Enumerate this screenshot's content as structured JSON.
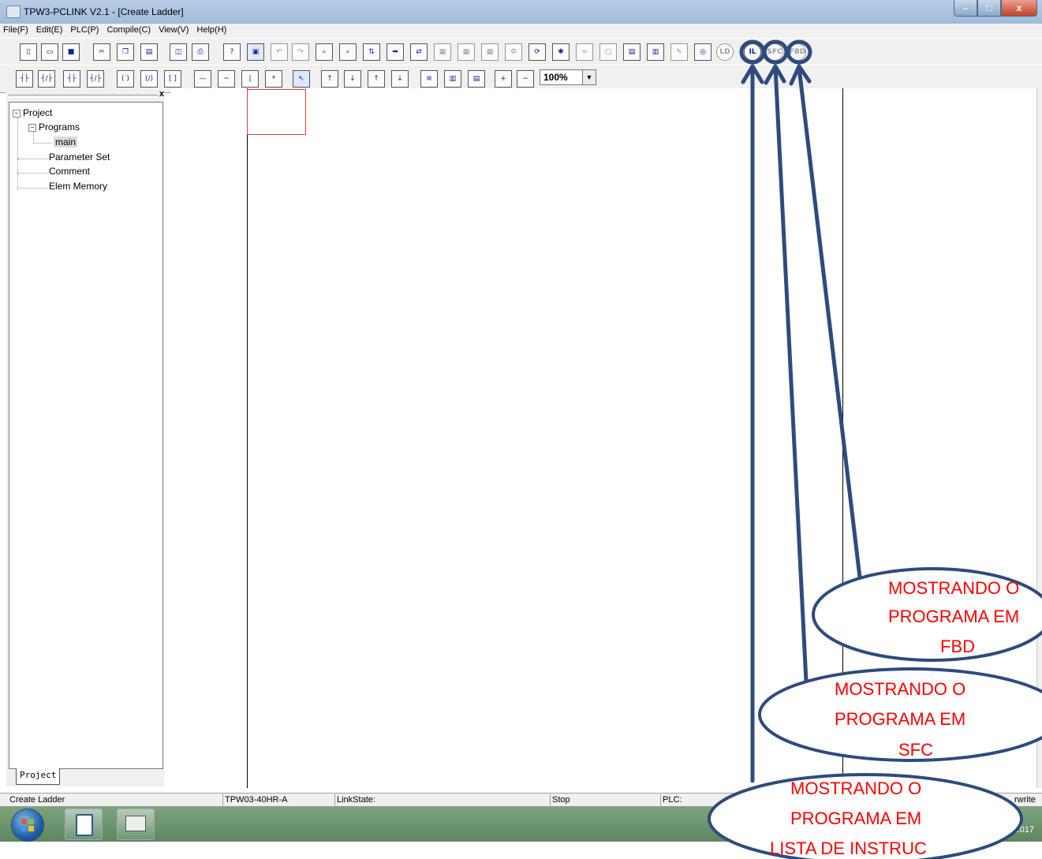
{
  "window": {
    "title": "TPW3-PCLINK V2.1 - [Create Ladder]",
    "minimize": "–",
    "maximize": "□",
    "close": "x"
  },
  "menu": [
    "File(F)",
    "Edit(E)",
    "PLC(P)",
    "Compile(C)",
    "View(V)",
    "Help(H)"
  ],
  "toolbar1": {
    "il_label": "IL",
    "sfc_label": "SFC",
    "fbd_label": "FBD",
    "ld_label": "LD"
  },
  "toolbar2": {
    "zoom": "100%",
    "zoom_arrow": "▼"
  },
  "project_tree": {
    "close": "x",
    "root": "Project",
    "programs": "Programs",
    "main": "main",
    "parameter_set": "Parameter Set",
    "comment": "Comment",
    "elem_memory": "Elem Memory",
    "tab": "Project"
  },
  "statusbar": {
    "mode": "Create Ladder",
    "model": "TPW03-40HR-A",
    "link_state": "LinkState:",
    "run_state": "Stop",
    "plc": "PLC:",
    "edit_mode": "rwrite"
  },
  "taskbar": {
    "clock": "2017"
  },
  "annotations": {
    "accent": "#2e4b7e",
    "text_color": "#ff0000",
    "fbd": [
      "MOSTRANDO O",
      "PROGRAMA EM",
      "FBD"
    ],
    "sfc": [
      "MOSTRANDO O",
      "PROGRAMA EM",
      "SFC"
    ],
    "il": [
      "MOSTRANDO O",
      "PROGRAMA EM",
      "LISTA DE INSTRUC"
    ]
  }
}
